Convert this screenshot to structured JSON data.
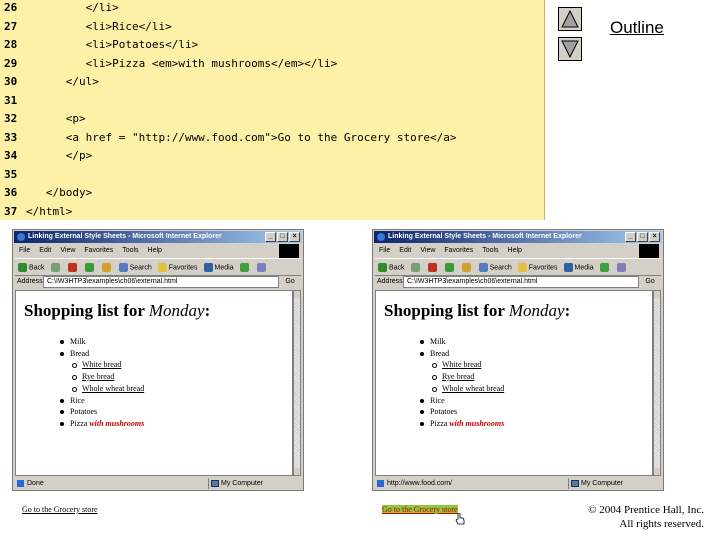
{
  "code": {
    "lines": [
      {
        "num": "26",
        "html": "         &lt;/li&gt;"
      },
      {
        "num": "27",
        "html": "         &lt;li&gt;Rice&lt;/li&gt;"
      },
      {
        "num": "28",
        "html": "         &lt;li&gt;Potatoes&lt;/li&gt;"
      },
      {
        "num": "29",
        "html": "         &lt;li&gt;Pizza &lt;em&gt;with mushrooms&lt;/em&gt;&lt;/li&gt;"
      },
      {
        "num": "30",
        "html": "      &lt;/ul&gt;"
      },
      {
        "num": "31",
        "html": ""
      },
      {
        "num": "32",
        "html": "      &lt;p&gt;"
      },
      {
        "num": "33",
        "html": "      &lt;a href = \"http://www.food.com\"&gt;Go to the Grocery store&lt;/a&gt;"
      },
      {
        "num": "34",
        "html": "      &lt;/p&gt;"
      },
      {
        "num": "35",
        "html": ""
      },
      {
        "num": "36",
        "html": "   &lt;/body&gt;"
      },
      {
        "num": "37",
        "html": "&lt;/html&gt;"
      }
    ]
  },
  "nav": {
    "outline_label": "Outline",
    "up_icon": "triangle-up-icon",
    "down_icon": "triangle-down-icon"
  },
  "windows": [
    {
      "title": "Linking External Style Sheets - Microsoft Internet Explorer",
      "menu": [
        "File",
        "Edit",
        "View",
        "Favorites",
        "Tools",
        "Help"
      ],
      "toolbar": {
        "back": "Back",
        "search": "Search",
        "favorites": "Favorites",
        "media": "Media"
      },
      "address_label": "Address",
      "address_value": "C:\\IW3HTP3\\examples\\ch06\\external.html",
      "go_label": "Go",
      "page": {
        "heading_prefix": "Shopping list for ",
        "heading_em": "Monday",
        "heading_suffix": ":",
        "items": [
          "Milk",
          "Bread"
        ],
        "sub_items": [
          "White bread",
          "Rye bread",
          "Whole wheat bread"
        ],
        "items_after": [
          "Rice",
          "Potatoes"
        ],
        "pizza": "Pizza ",
        "pizza_em": "with mushrooms",
        "link_text": "Go to the Grocery store"
      },
      "status_text": "Done",
      "zone_text": "My Computer"
    },
    {
      "title": "Linking External Style Sheets - Microsoft Internet Explorer",
      "menu": [
        "File",
        "Edit",
        "View",
        "Favorites",
        "Tools",
        "Help"
      ],
      "toolbar": {
        "back": "Back",
        "search": "Search",
        "favorites": "Favorites",
        "media": "Media"
      },
      "address_label": "Address",
      "address_value": "C:\\IW3HTP3\\examples\\ch06\\external.html",
      "go_label": "Go",
      "page": {
        "heading_prefix": "Shopping list for ",
        "heading_em": "Monday",
        "heading_suffix": ":",
        "items": [
          "Milk",
          "Bread"
        ],
        "sub_items": [
          "White bread",
          "Rye bread",
          "Whole wheat bread"
        ],
        "items_after": [
          "Rice",
          "Potatoes"
        ],
        "pizza": "Pizza ",
        "pizza_em": "with mushrooms",
        "link_text": "Go to the Grocery store"
      },
      "status_text": "http://www.food.com/",
      "zone_text": "My Computer"
    }
  ],
  "copyright": {
    "line1": "© 2004 Prentice Hall, Inc.",
    "line2": "All rights reserved."
  }
}
